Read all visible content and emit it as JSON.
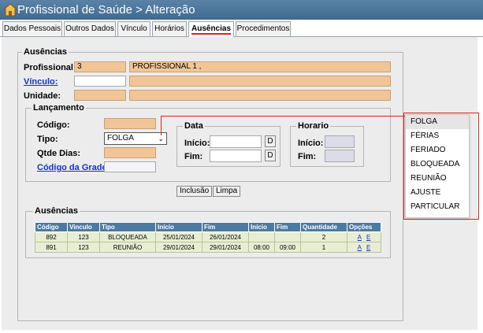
{
  "window": {
    "title": "Profissional de Saúde > Alteração"
  },
  "tabs": [
    {
      "label": "Dados Pessoais"
    },
    {
      "label": "Outros Dados"
    },
    {
      "label": "Vínculo"
    },
    {
      "label": "Horários"
    },
    {
      "label": "Ausências"
    },
    {
      "label": "Procedimentos"
    }
  ],
  "ausencias_section": {
    "legend": "Ausências",
    "profissional_label": "Profissional:",
    "profissional_code": "3",
    "profissional_name": "PROFISSIONAL 1                       ,",
    "vinculo_label": "Vínculo:",
    "vinculo_code": "",
    "vinculo_desc": "",
    "unidade_label": "Unidade:",
    "unidade_code": "",
    "unidade_desc": ""
  },
  "lancamento": {
    "legend": "Lançamento",
    "codigo_label": "Código:",
    "codigo_value": "",
    "tipo_label": "Tipo:",
    "tipo_selected": "FOLGA",
    "qtde_label": "Qtde Dias:",
    "qtde_value": "",
    "codigo_grade_label": "Código da Grade:",
    "codigo_grade_value": "",
    "data": {
      "legend": "Data",
      "inicio_label": "Início:",
      "fim_label": "Fim:",
      "inicio_value": "",
      "fim_value": "",
      "date_button": "D"
    },
    "horario": {
      "legend": "Horario",
      "inicio_label": "Início:",
      "fim_label": "Fim:"
    }
  },
  "buttons": {
    "inclusao": "Inclusão",
    "limpa": "Limpa"
  },
  "grid": {
    "legend": "Ausências",
    "headers": [
      "Código",
      "Vinculo",
      "Tipo",
      "Início",
      "Fim",
      "Início",
      "Fim",
      "Quantidade",
      "Opções"
    ],
    "rows": [
      {
        "codigo": "892",
        "vinculo": "123",
        "tipo": "BLOQUEADA",
        "data_inicio": "25/01/2024",
        "data_fim": "26/01/2024",
        "hora_inicio": "",
        "hora_fim": "",
        "quantidade": "2",
        "a": "A",
        "e": "E"
      },
      {
        "codigo": "891",
        "vinculo": "123",
        "tipo": "REUNIÃO",
        "data_inicio": "29/01/2024",
        "data_fim": "29/01/2024",
        "hora_inicio": "08:00",
        "hora_fim": "09:00",
        "quantidade": "1",
        "a": "A",
        "e": "E"
      }
    ]
  },
  "tipo_dropdown": {
    "options": [
      "FOLGA",
      "FÉRIAS",
      "FERIADO",
      "BLOQUEADA",
      "REUNIÃO",
      "AJUSTE",
      "PARTICULAR"
    ]
  },
  "colors": {
    "title_bar": "#4a7499",
    "readonly_field": "#f2c597",
    "grid_header": "#4d7aa0",
    "grid_row": "#e8eed4",
    "highlight_frame": "#dd2222"
  }
}
